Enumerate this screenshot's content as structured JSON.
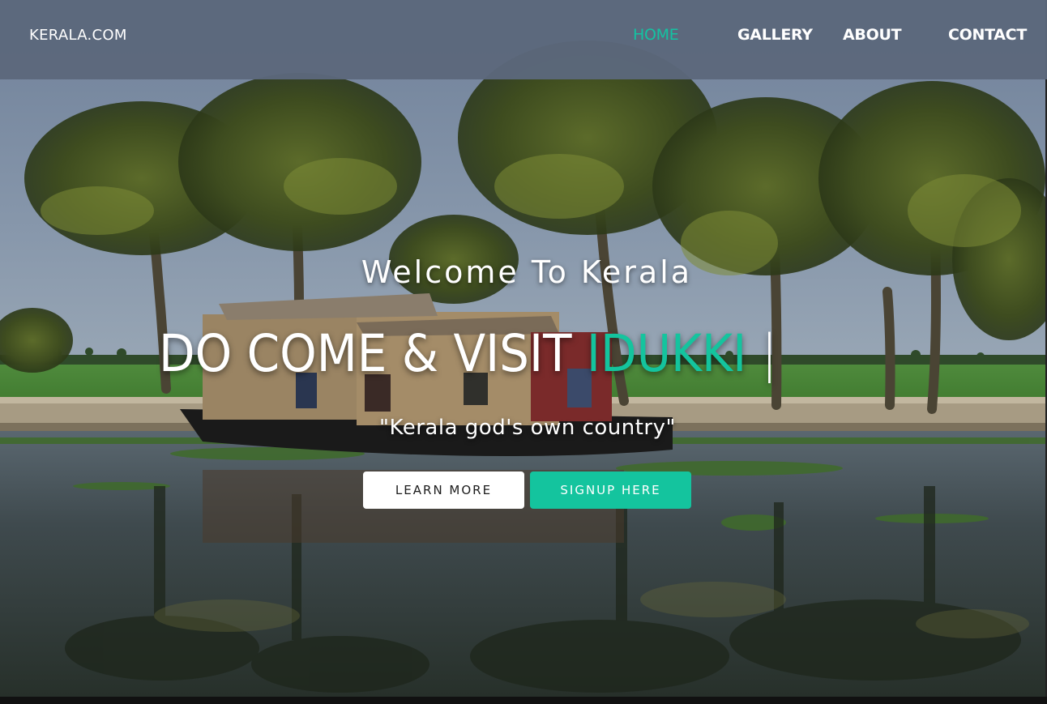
{
  "navbar": {
    "brand": "KERALA.COM",
    "links": [
      {
        "label": "HOME",
        "active": true
      },
      {
        "label": "GALLERY",
        "active": false
      },
      {
        "label": "ABOUT",
        "active": false
      },
      {
        "label": "CONTACT",
        "active": false
      }
    ]
  },
  "hero": {
    "welcome": "Welcome To Kerala",
    "headline_prefix": "DO COME & VISIT ",
    "headline_highlight": "IDUKKI",
    "headline_cursor": " |",
    "tagline": "\"Kerala god's own country\"",
    "buttons": {
      "learn_more": "LEARN MORE",
      "signup": "SIGNUP HERE"
    },
    "background_description_icon": "backwaters-houseboat-palm-photo"
  },
  "colors": {
    "accent": "#14c49e",
    "navbar": "#5c687c",
    "text": "#ffffff"
  }
}
